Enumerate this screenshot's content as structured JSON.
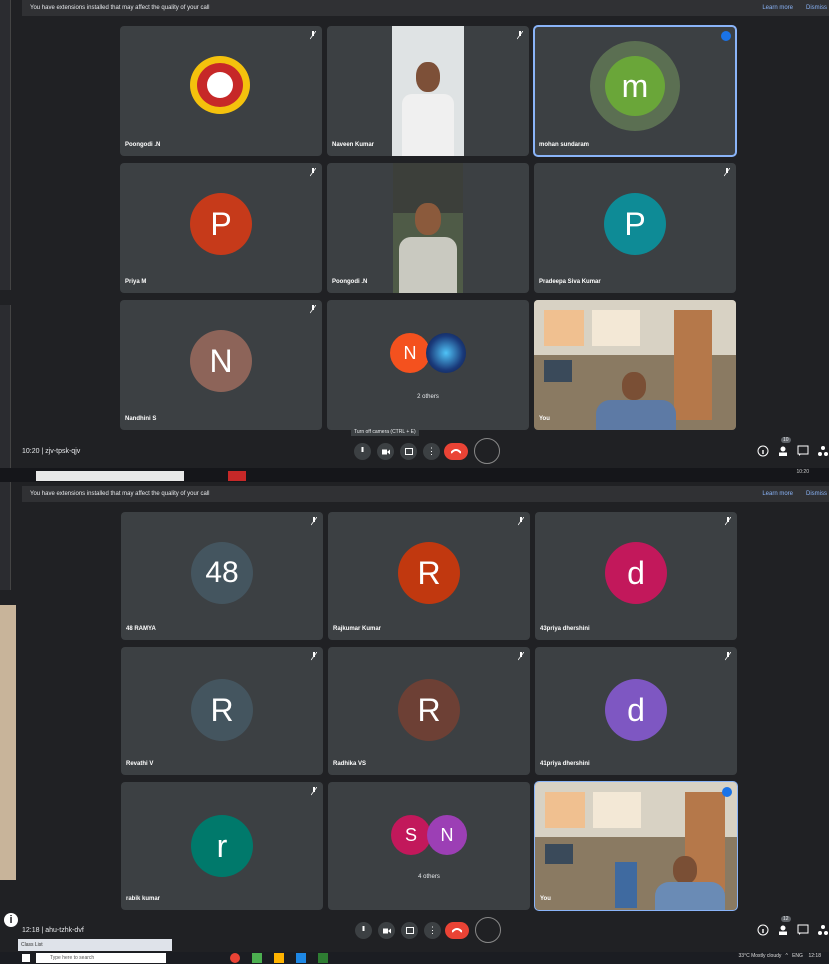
{
  "top_window": {
    "banner": {
      "message": "You have extensions installed that may affect the quality of your call",
      "learn_more": "Learn more",
      "dismiss": "Dismiss"
    },
    "participants": [
      {
        "name": "Poongodi .N",
        "type": "logo"
      },
      {
        "name": "Naveen Kumar",
        "type": "video"
      },
      {
        "name": "mohan sundaram",
        "initial": "m",
        "color": "#6aa639",
        "speaking": true
      },
      {
        "name": "Priya M",
        "initial": "P",
        "color": "#c63a1a"
      },
      {
        "name": "Poongodi .N",
        "type": "video"
      },
      {
        "name": "Pradeepa Siva Kumar",
        "initial": "P",
        "color": "#0e8b96"
      },
      {
        "name": "Nandhini S",
        "initial": "N",
        "color": "#8d6459"
      },
      {
        "name": "2 others",
        "initials": [
          "N",
          ""
        ],
        "colors": [
          "#f4511e",
          "#1a3a7a"
        ]
      },
      {
        "name": "You",
        "type": "video"
      }
    ],
    "tooltip": "Turn off camera (CTRL + E)",
    "time": "10:20",
    "meeting_code": "zjv-tpsk-qjv",
    "people_count": "10",
    "mini_clock": "10:20"
  },
  "bottom_window": {
    "banner": {
      "message": "You have extensions installed that may affect the quality of your call",
      "learn_more": "Learn more",
      "dismiss": "Dismiss"
    },
    "participants": [
      {
        "name": "48 RAMYA",
        "initial": "48",
        "color": "#44555f"
      },
      {
        "name": "Rajkumar Kumar",
        "initial": "R",
        "color": "#c1380f"
      },
      {
        "name": "43priya dhershini",
        "initial": "d",
        "color": "#c2185b"
      },
      {
        "name": "Revathi V",
        "initial": "R",
        "color": "#44555f"
      },
      {
        "name": "Radhika VS",
        "initial": "R",
        "color": "#6d4035"
      },
      {
        "name": "41priya dhershini",
        "initial": "d",
        "color": "#7e57c2"
      },
      {
        "name": "rabik kumar",
        "initial": "r",
        "color": "#00796b"
      },
      {
        "name": "4 others",
        "initials": [
          "S",
          "N"
        ],
        "colors": [
          "#c2185b",
          "#9c3fb5"
        ]
      },
      {
        "name": "You",
        "type": "video"
      }
    ],
    "time": "12:18",
    "meeting_code": "ahu-tzhk-dvf",
    "people_count": "12"
  },
  "taskbar": {
    "search_placeholder": "Type here to search",
    "weather": "33°C  Mostly cloudy",
    "language": "ENG",
    "clock": "12:18",
    "class_list": "Class List"
  },
  "colors": {
    "bg": "#202124",
    "tile": "#3c4043",
    "end_call": "#ea4335",
    "accent": "#8ab4f8"
  }
}
